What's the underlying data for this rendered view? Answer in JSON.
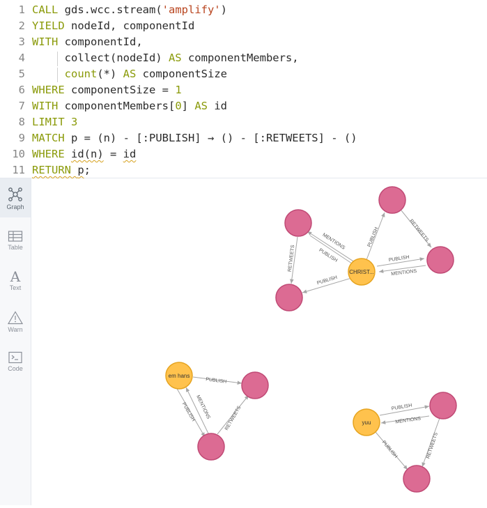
{
  "editor": {
    "lines": [
      {
        "n": "1",
        "segs": [
          {
            "c": "kw",
            "t": "CALL "
          },
          {
            "c": "tx",
            "t": "gds.wcc.stream("
          },
          {
            "c": "str",
            "t": "'amplify'"
          },
          {
            "c": "tx",
            "t": ")"
          }
        ]
      },
      {
        "n": "2",
        "segs": [
          {
            "c": "kw",
            "t": "YIELD "
          },
          {
            "c": "tx",
            "t": "nodeId, componentId"
          }
        ]
      },
      {
        "n": "3",
        "segs": [
          {
            "c": "kw",
            "t": "WITH "
          },
          {
            "c": "tx",
            "t": "componentId,"
          }
        ]
      },
      {
        "n": "4",
        "segs": [
          {
            "c": "tx",
            "t": "     collect(nodeId) "
          },
          {
            "c": "kw",
            "t": "AS "
          },
          {
            "c": "tx",
            "t": "componentMembers,"
          }
        ]
      },
      {
        "n": "5",
        "segs": [
          {
            "c": "tx",
            "t": "     "
          },
          {
            "c": "kw",
            "t": "count"
          },
          {
            "c": "tx",
            "t": "(*) "
          },
          {
            "c": "kw",
            "t": "AS "
          },
          {
            "c": "tx",
            "t": "componentSize"
          }
        ]
      },
      {
        "n": "6",
        "segs": [
          {
            "c": "kw",
            "t": "WHERE "
          },
          {
            "c": "tx",
            "t": "componentSize = "
          },
          {
            "c": "num",
            "t": "1"
          }
        ]
      },
      {
        "n": "7",
        "segs": [
          {
            "c": "kw",
            "t": "WITH "
          },
          {
            "c": "tx",
            "t": "componentMembers["
          },
          {
            "c": "num",
            "t": "0"
          },
          {
            "c": "tx",
            "t": "] "
          },
          {
            "c": "kw",
            "t": "AS "
          },
          {
            "c": "tx",
            "t": "id"
          }
        ]
      },
      {
        "n": "8",
        "segs": [
          {
            "c": "kw",
            "t": "LIMIT "
          },
          {
            "c": "num",
            "t": "3"
          }
        ]
      },
      {
        "n": "9",
        "segs": [
          {
            "c": "kw",
            "t": "MATCH "
          },
          {
            "c": "tx",
            "t": "p = (n) - [:PUBLISH] → () - [:RETWEETS] - ()"
          }
        ]
      },
      {
        "n": "10",
        "segs": [
          {
            "c": "kw",
            "t": "WHERE "
          },
          {
            "c": "tx wavy",
            "t": "id(n)"
          },
          {
            "c": "tx",
            "t": " = "
          },
          {
            "c": "tx wavy",
            "t": "id"
          }
        ]
      },
      {
        "n": "11",
        "segs": [
          {
            "c": "kw wavy",
            "t": "RETURN "
          },
          {
            "c": "tx wavy",
            "t": "p"
          },
          {
            "c": "tx",
            "t": ";"
          }
        ]
      }
    ]
  },
  "sidebar": {
    "tabs": [
      {
        "label": "Graph",
        "icon": "graph-icon",
        "active": true
      },
      {
        "label": "Table",
        "icon": "table-icon",
        "active": false
      },
      {
        "label": "Text",
        "icon": "text-icon",
        "active": false
      },
      {
        "label": "Warn",
        "icon": "warn-icon",
        "active": false
      },
      {
        "label": "Code",
        "icon": "code-icon",
        "active": false
      }
    ]
  },
  "graph": {
    "colors": {
      "user": "#dc6b93",
      "user_stroke": "#c04a75",
      "tweet": "#ffc24d",
      "tweet_stroke": "#e6a420",
      "edge": "#a6a6a6"
    },
    "node_labels": {
      "christ": "CHRIST...",
      "emhans": "em hans",
      "yuu": "yuu"
    },
    "edge_labels": {
      "g1_mentions_1": "MENTIONS",
      "g1_publish_1": "PUBLISH",
      "g1_retweets_1": "RETWEETS",
      "g1_publish_2": "PUBLISH",
      "g1_publish_3": "PUBLISH",
      "g1_retweets_2": "RETWEETS",
      "g1_publish_4": "PUBLISH",
      "g1_mentions_2": "MENTIONS",
      "g2_publish_1": "PUBLISH",
      "g2_publish_2": "PUBLISH",
      "g2_mentions": "MENTIONS",
      "g2_retweets": "RETWEETS",
      "g3_publish_1": "PUBLISH",
      "g3_mentions": "MENTIONS",
      "g3_retweets": "RETWEETS",
      "g3_publish_2": "PUBLISH"
    }
  }
}
